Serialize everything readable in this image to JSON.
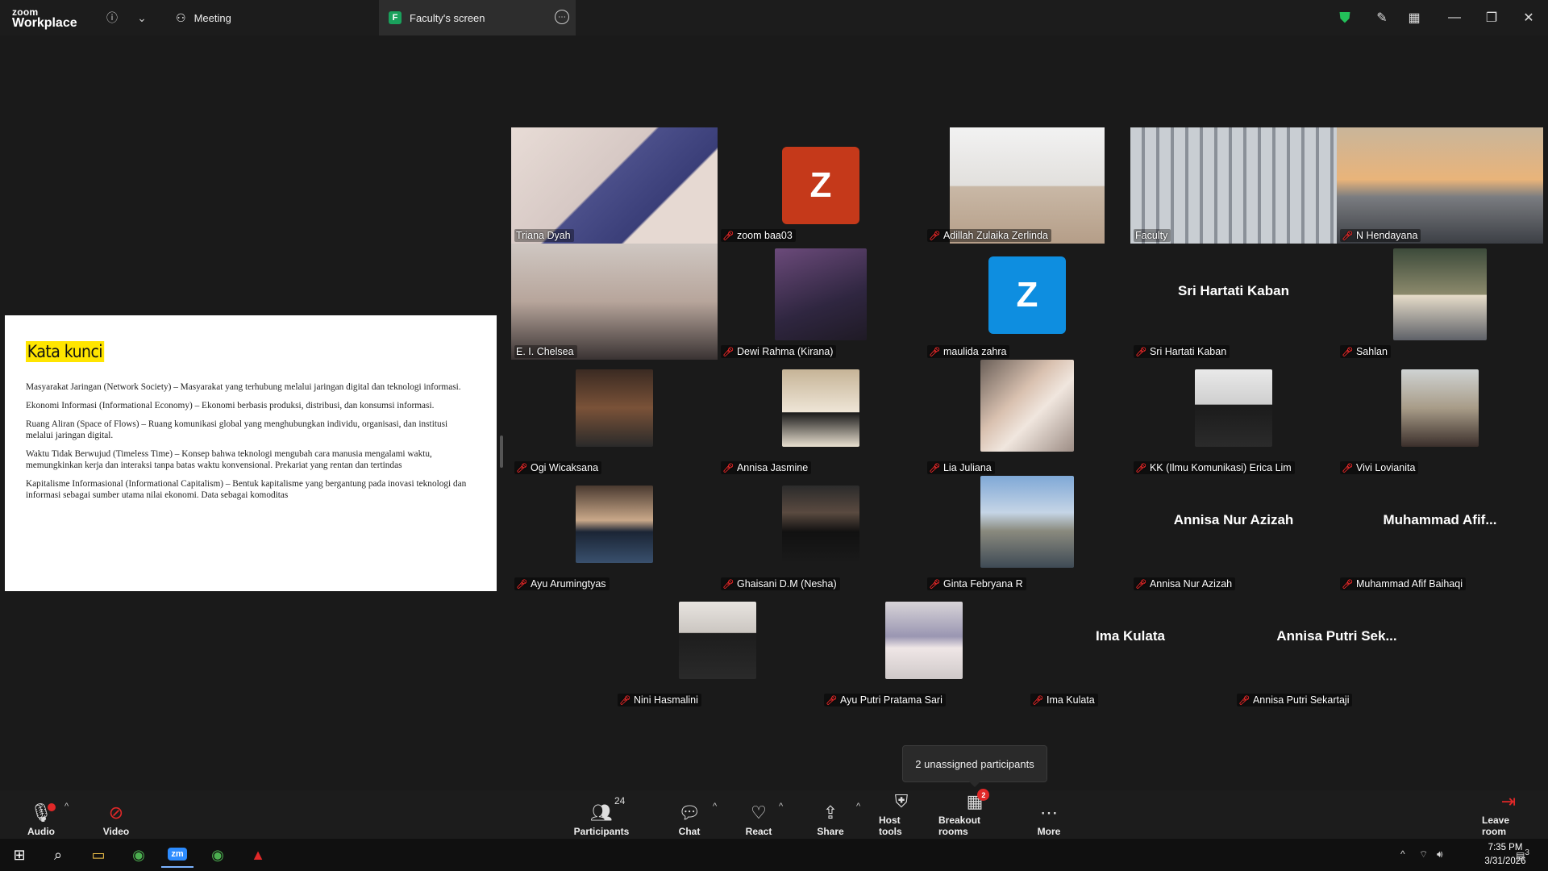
{
  "titlebar": {
    "logo_line1": "zoom",
    "logo_line2": "Workplace",
    "tab_meeting": "Meeting",
    "tab_screen": "Faculty's screen",
    "tab_screen_badge": "F"
  },
  "slide": {
    "title": "Kata kunci",
    "paragraphs": [
      "Masyarakat Jaringan (Network Society) – Masyarakat yang terhubung melalui jaringan digital dan teknologi informasi.",
      "Ekonomi Informasi (Informational Economy) – Ekonomi berbasis produksi, distribusi, dan konsumsi informasi.",
      "Ruang Aliran (Space of Flows) – Ruang komunikasi global yang menghubungkan individu, organisasi, dan institusi melalui jaringan digital.",
      "Waktu Tidak Berwujud (Timeless Time) – Konsep bahwa teknologi mengubah cara manusia mengalami waktu, memungkinkan kerja dan interaksi tanpa batas waktu konvensional. Prekariat yang rentan dan tertindas",
      "Kapitalisme Informasional (Informational Capitalism) – Bentuk kapitalisme yang bergantung pada inovasi teknologi dan informasi sebagai sumber utama nilai ekonomi. Data sebagai komoditas"
    ]
  },
  "participants": [
    {
      "name": "Triana Dyah",
      "muted": false
    },
    {
      "name": "zoom baa03",
      "muted": true,
      "letter": "Z"
    },
    {
      "name": "Adillah Zulaika Zerlinda",
      "muted": true
    },
    {
      "name": "Faculty",
      "muted": false
    },
    {
      "name": "N Hendayana",
      "muted": true
    },
    {
      "name": "E. I. Chelsea",
      "muted": false
    },
    {
      "name": "Dewi Rahma (Kirana)",
      "muted": true
    },
    {
      "name": "maulida zahra",
      "muted": true,
      "letter": "Z"
    },
    {
      "name": "Sri Hartati Kaban",
      "muted": true,
      "display": "Sri Hartati Kaban"
    },
    {
      "name": "Sahlan",
      "muted": true
    },
    {
      "name": "Ogi Wicaksana",
      "muted": true
    },
    {
      "name": "Annisa Jasmine",
      "muted": true
    },
    {
      "name": "Lia Juliana",
      "muted": true
    },
    {
      "name": "KK (Ilmu Komunikasi) Erica Lim",
      "muted": true
    },
    {
      "name": "Vivi Lovianita",
      "muted": true
    },
    {
      "name": "Ayu Arumingtyas",
      "muted": true
    },
    {
      "name": "Ghaisani D.M (Nesha)",
      "muted": true
    },
    {
      "name": "Ginta Febryana R",
      "muted": true
    },
    {
      "name": "Annisa Nur Azizah",
      "muted": true,
      "display": "Annisa Nur Azizah"
    },
    {
      "name": "Muhammad Afif Baihaqi",
      "muted": true,
      "display": "Muhammad  Afif..."
    },
    {
      "name": "Nini Hasmalini",
      "muted": true
    },
    {
      "name": "Ayu Putri Pratama Sari",
      "muted": true
    },
    {
      "name": "Ima Kulata",
      "muted": true,
      "display": "Ima Kulata"
    },
    {
      "name": "Annisa Putri Sekartaji",
      "muted": true,
      "display": "Annisa  Putri  Sek..."
    }
  ],
  "tooltip": "2 unassigned participants",
  "toolbar": {
    "audio": "Audio",
    "video": "Video",
    "participants": "Participants",
    "participants_count": "24",
    "chat": "Chat",
    "react": "React",
    "share": "Share",
    "host_tools": "Host tools",
    "breakout": "Breakout rooms",
    "breakout_badge": "2",
    "more": "More",
    "leave": "Leave room"
  },
  "taskbar": {
    "time": "7:35 PM",
    "date": "3/31/2026",
    "notif_count": "3"
  },
  "colors": {
    "accent_green": "#23d96a",
    "mute_red": "#e02828",
    "zoom_orange": "#c5391a",
    "zoom_blue": "#0e8ee0",
    "highlight_yellow": "#ffe500"
  }
}
